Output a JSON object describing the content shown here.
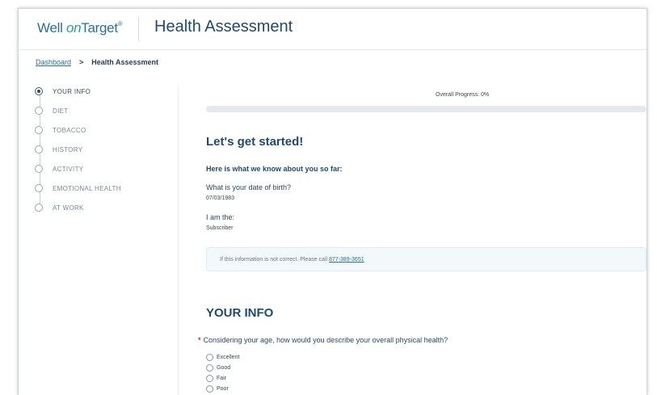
{
  "header": {
    "logo": {
      "well": "Well",
      "on": "on",
      "target": "Target",
      "tm": "®"
    },
    "title": "Health Assessment"
  },
  "breadcrumb": {
    "home": "Dashboard",
    "separator": ">",
    "current": "Health Assessment"
  },
  "sidebar": {
    "steps": [
      {
        "label": "YOUR INFO",
        "active": true
      },
      {
        "label": "DIET",
        "active": false
      },
      {
        "label": "TOBACCO",
        "active": false
      },
      {
        "label": "HISTORY",
        "active": false
      },
      {
        "label": "ACTIVITY",
        "active": false
      },
      {
        "label": "EMOTIONAL HEALTH",
        "active": false
      },
      {
        "label": "AT WORK",
        "active": false
      }
    ]
  },
  "progress": {
    "label": "Overall Progress: 0%",
    "percent": 0
  },
  "intro": {
    "heading": "Let's get started!",
    "known": "Here is what we know about you so far:",
    "dob_question": "What is your date of birth?",
    "dob_value": "07/03/1983",
    "role_question": "I am the:",
    "role_value": "Subscriber"
  },
  "notice": {
    "text": "If this information is not correct. Please call",
    "phone": "877-389-3651"
  },
  "section": {
    "heading": "YOUR INFO",
    "required_marker": "*",
    "question": "Considering your age, how would you describe your overall physical health?",
    "options": [
      "Excellent",
      "Good",
      "Fair",
      "Poor"
    ]
  },
  "colors": {
    "brand_blue": "#1f4a6e",
    "accent_teal": "#2b9b9c",
    "link_blue": "#2a6fa0",
    "required_red": "#d03030"
  }
}
